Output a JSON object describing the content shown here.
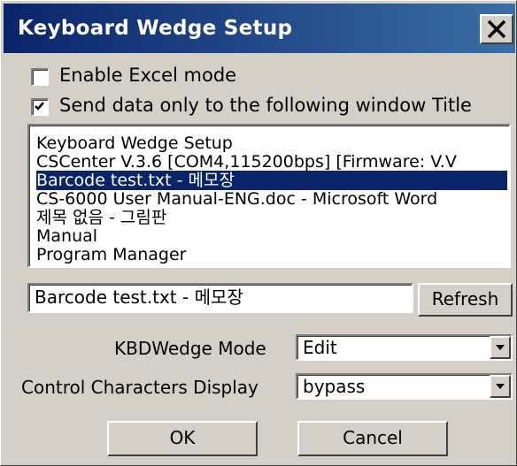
{
  "window": {
    "title": "Keyboard Wedge Setup"
  },
  "options": {
    "excel_mode": {
      "label": "Enable Excel mode",
      "checked": false
    },
    "send_only": {
      "label": "Send data only to the following window Title",
      "checked": true
    }
  },
  "window_list": {
    "items": [
      "Keyboard Wedge Setup",
      "CSCenter V.3.6    [COM4,115200bps] [Firmware: V.V",
      "Barcode test.txt - 메모장",
      "CS-6000 User Manual-ENG.doc - Microsoft Word",
      "제목 없음 - 그림판",
      "Manual",
      "Program Manager"
    ],
    "selected_index": 2
  },
  "title_field": {
    "value": "Barcode test.txt - 메모장"
  },
  "refresh_button": {
    "label": "Refresh"
  },
  "kbd_mode": {
    "label": "KBDWedge Mode",
    "value": "Edit"
  },
  "control_chars": {
    "label": "Control Characters Display",
    "value": "bypass"
  },
  "ok_button": {
    "label": "OK"
  },
  "cancel_button": {
    "label": "Cancel"
  },
  "colors": {
    "titlebar_start": "#0a246a",
    "titlebar_end": "#3a6ea5",
    "selection": "#0a246a",
    "dialog_bg": "#d4d0c8"
  }
}
